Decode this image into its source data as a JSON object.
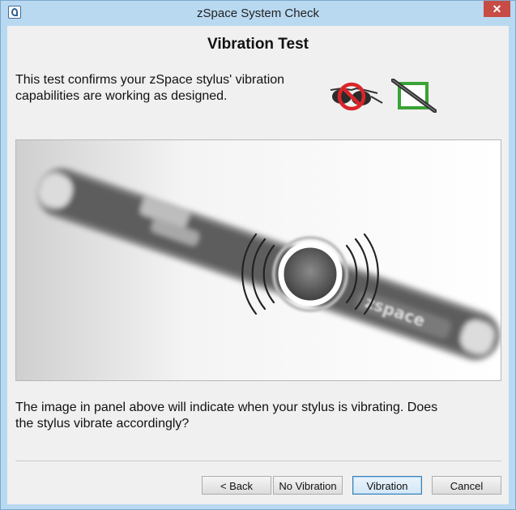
{
  "window": {
    "title": "zSpace System Check",
    "close_glyph": "✕",
    "icon": "zspace-app-icon"
  },
  "page": {
    "heading": "Vibration Test",
    "intro": "This test confirms your zSpace stylus' vibration\ncapabilities are working as designed.",
    "question": "The image in panel above will indicate when your stylus is vibrating. Does\nthe stylus vibrate accordingly?"
  },
  "icons": {
    "glasses": "glasses-not-required-icon",
    "stylus": "stylus-checked-icon",
    "prohibit_color": "#d9252a",
    "check_color": "#3aa335"
  },
  "stylus_image": {
    "brand_text": "zspace"
  },
  "buttons": {
    "back": "< Back",
    "no_vibration": "No Vibration",
    "vibration": "Vibration",
    "cancel": "Cancel"
  }
}
